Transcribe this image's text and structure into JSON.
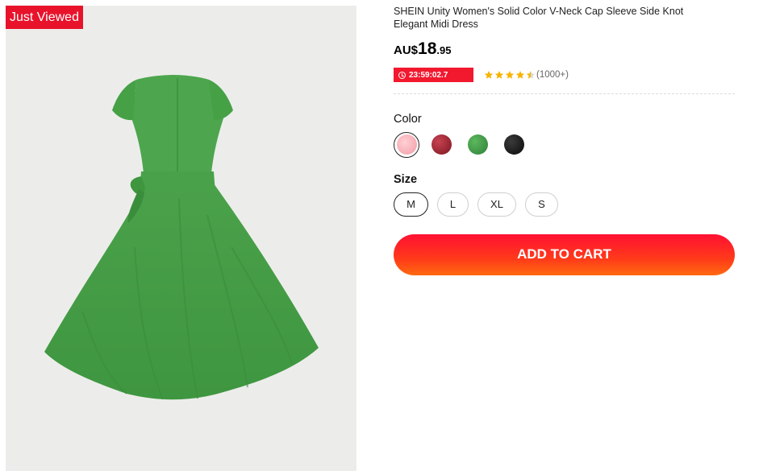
{
  "badge": "Just Viewed",
  "product": {
    "title": "SHEIN Unity Women's Solid Color V-Neck Cap Sleeve Side Knot Elegant Midi Dress",
    "price_currency": "AU$",
    "price_whole": "18",
    "price_decimal": ".95",
    "timer": "23:59:02.7",
    "rating": 4.5,
    "reviews": "(1000+)"
  },
  "color": {
    "label": "Color",
    "options": [
      {
        "name": "pink",
        "hex": "#f6a7b0",
        "selected": true
      },
      {
        "name": "burgundy",
        "hex": "#a3222f",
        "selected": false
      },
      {
        "name": "green",
        "hex": "#3a9a4a",
        "selected": false
      },
      {
        "name": "black",
        "hex": "#151515",
        "selected": false
      }
    ]
  },
  "size": {
    "label": "Size",
    "options": [
      "M",
      "L",
      "XL",
      "S"
    ],
    "selected": "M"
  },
  "cart": {
    "label": "ADD TO CART"
  },
  "colors": {
    "accent": "#f2182e",
    "star": "#f7b500",
    "dress": "#4ea54e"
  }
}
